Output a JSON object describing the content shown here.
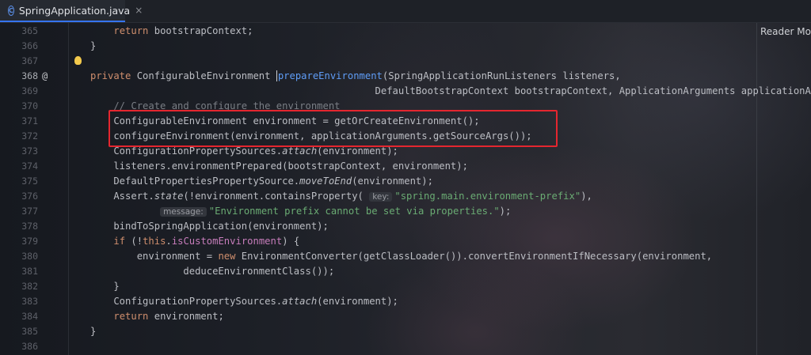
{
  "tab": {
    "title": "SpringApplication.java",
    "icon": "java-class-icon",
    "close": "×"
  },
  "reader_mode": "Reader Mod",
  "lines": [
    {
      "n": "365",
      "segments": [
        {
          "t": "    ",
          "c": ""
        },
        {
          "t": "return",
          "c": "kw"
        },
        {
          "t": " bootstrapContext;",
          "c": ""
        }
      ]
    },
    {
      "n": "366",
      "segments": [
        {
          "t": "}",
          "c": ""
        }
      ]
    },
    {
      "n": "367",
      "segments": []
    },
    {
      "n": "368",
      "segments": [
        {
          "t": "private",
          "c": "kw"
        },
        {
          "t": " ConfigurableEnvironment ",
          "c": ""
        },
        {
          "t": "prepareEnvironment",
          "c": "sel"
        },
        {
          "t": "(SpringApplicationRunListeners listeners,",
          "c": ""
        }
      ]
    },
    {
      "n": "369",
      "segments": [
        {
          "t": "                                                 DefaultBootstrapContext bootstrapContext, ApplicationArguments applicationArgume",
          "c": ""
        }
      ]
    },
    {
      "n": "370",
      "segments": [
        {
          "t": "    // Create and configure the environment",
          "c": "cmt"
        }
      ]
    },
    {
      "n": "371",
      "segments": [
        {
          "t": "    ConfigurableEnvironment environment = getOrCreateEnvironment();",
          "c": ""
        }
      ]
    },
    {
      "n": "372",
      "segments": [
        {
          "t": "    configureEnvironment(environment, applicationArguments.getSourceArgs());",
          "c": ""
        }
      ]
    },
    {
      "n": "373",
      "segments": [
        {
          "t": "    ConfigurationPropertySources.",
          "c": ""
        },
        {
          "t": "attach",
          "c": "it"
        },
        {
          "t": "(environment);",
          "c": ""
        }
      ]
    },
    {
      "n": "374",
      "segments": [
        {
          "t": "    listeners.environmentPrepared(bootstrapContext, environment);",
          "c": ""
        }
      ]
    },
    {
      "n": "375",
      "segments": [
        {
          "t": "    DefaultPropertiesPropertySource.",
          "c": ""
        },
        {
          "t": "moveToEnd",
          "c": "it"
        },
        {
          "t": "(environment);",
          "c": ""
        }
      ]
    },
    {
      "n": "376",
      "segments": [
        {
          "t": "    Assert.",
          "c": ""
        },
        {
          "t": "state",
          "c": "it"
        },
        {
          "t": "(!environment.containsProperty( ",
          "c": ""
        },
        {
          "t": "key:",
          "c": "hint"
        },
        {
          "t": "\"spring.main.environment-prefix\"",
          "c": "str"
        },
        {
          "t": "),",
          "c": ""
        }
      ]
    },
    {
      "n": "377",
      "segments": [
        {
          "t": "            ",
          "c": ""
        },
        {
          "t": "message:",
          "c": "hint"
        },
        {
          "t": "\"Environment prefix cannot be set via properties.\"",
          "c": "str"
        },
        {
          "t": ");",
          "c": ""
        }
      ]
    },
    {
      "n": "378",
      "segments": [
        {
          "t": "    bindToSpringApplication(environment);",
          "c": ""
        }
      ]
    },
    {
      "n": "379",
      "segments": [
        {
          "t": "    ",
          "c": ""
        },
        {
          "t": "if",
          "c": "kw"
        },
        {
          "t": " (!",
          "c": ""
        },
        {
          "t": "this",
          "c": "kw"
        },
        {
          "t": ".",
          "c": ""
        },
        {
          "t": "isCustomEnvironment",
          "c": "field"
        },
        {
          "t": ") {",
          "c": ""
        }
      ]
    },
    {
      "n": "380",
      "segments": [
        {
          "t": "        environment = ",
          "c": ""
        },
        {
          "t": "new",
          "c": "kw"
        },
        {
          "t": " EnvironmentConverter(getClassLoader()).convertEnvironmentIfNecessary(environment,",
          "c": ""
        }
      ]
    },
    {
      "n": "381",
      "segments": [
        {
          "t": "                deduceEnvironmentClass());",
          "c": ""
        }
      ]
    },
    {
      "n": "382",
      "segments": [
        {
          "t": "    }",
          "c": ""
        }
      ]
    },
    {
      "n": "383",
      "segments": [
        {
          "t": "    ConfigurationPropertySources.",
          "c": ""
        },
        {
          "t": "attach",
          "c": "it"
        },
        {
          "t": "(environment);",
          "c": ""
        }
      ]
    },
    {
      "n": "384",
      "segments": [
        {
          "t": "    ",
          "c": ""
        },
        {
          "t": "return",
          "c": "kw"
        },
        {
          "t": " environment;",
          "c": ""
        }
      ]
    },
    {
      "n": "385",
      "segments": [
        {
          "t": "}",
          "c": ""
        }
      ]
    },
    {
      "n": "386",
      "segments": []
    }
  ],
  "gutter_override_icon": "@",
  "current_line": "368"
}
